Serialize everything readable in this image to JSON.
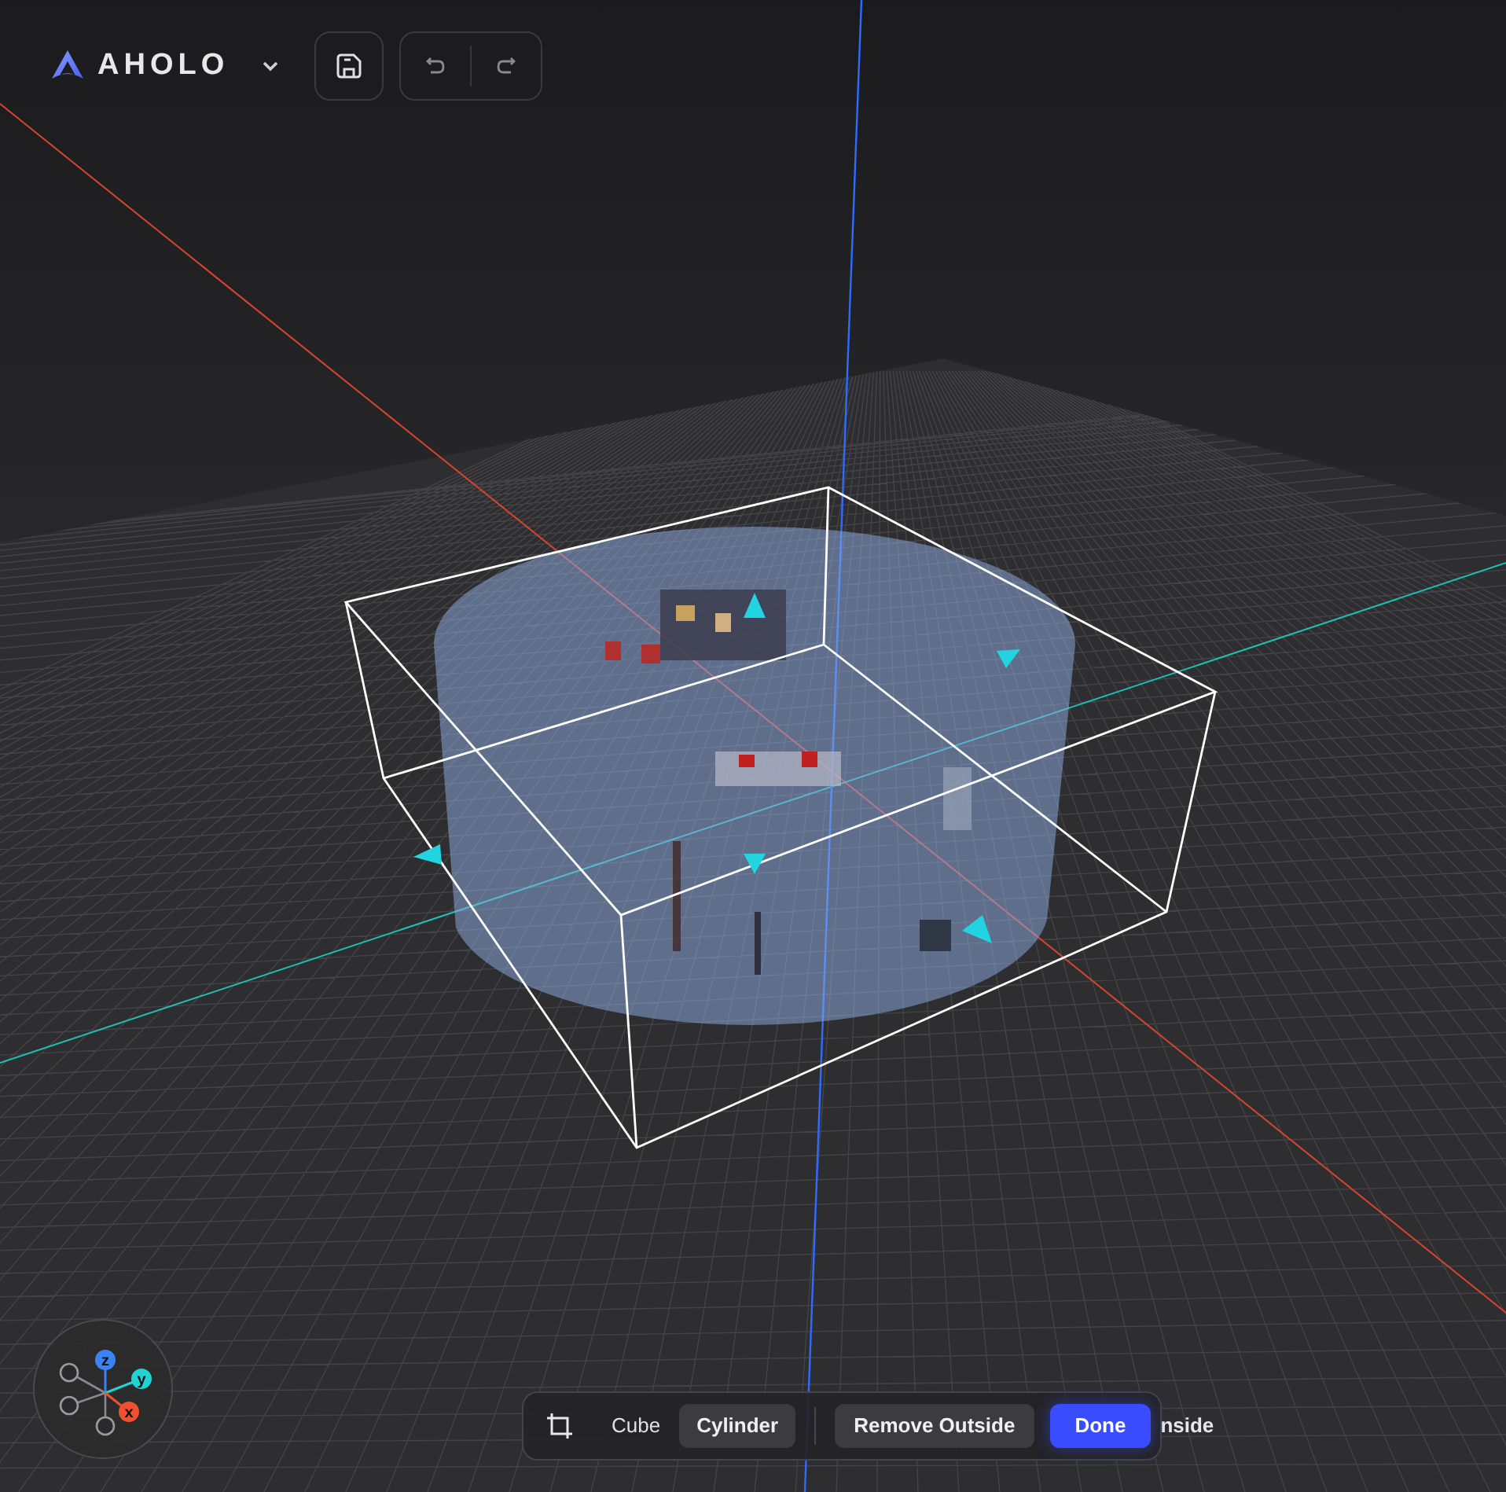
{
  "brand": {
    "name": "AHOLO"
  },
  "shape_options": [
    {
      "label": "Cube",
      "selected": false
    },
    {
      "label": "Cylinder",
      "selected": true
    }
  ],
  "actions": [
    {
      "label": "Remove Outside",
      "kind": "secondary"
    },
    {
      "label": "Done",
      "kind": "primary"
    }
  ],
  "hidden_action": {
    "label": "nside"
  },
  "gizmo": {
    "axes": [
      {
        "label": "z",
        "color": "#3b82f6"
      },
      {
        "label": "y",
        "color": "#22d3d3"
      },
      {
        "label": "x",
        "color": "#f0502e"
      }
    ]
  }
}
